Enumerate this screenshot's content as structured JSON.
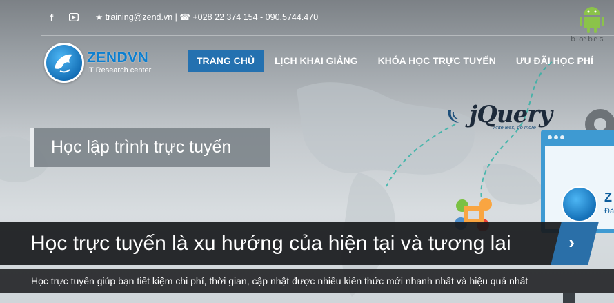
{
  "topbar": {
    "social": [
      {
        "icon": "facebook-icon",
        "glyph": "f"
      },
      {
        "icon": "youtube-icon",
        "glyph": "▶"
      }
    ],
    "contact_text": "★ training@zend.vn | ☎ +028 22 374 154 - 090.5744.470",
    "android_label": "android"
  },
  "logo": {
    "name": "ZENDVN",
    "tagline": "IT Research center"
  },
  "nav": {
    "items": [
      {
        "label": "TRANG CHỦ",
        "active": true
      },
      {
        "label": "LỊCH KHAI GIẢNG",
        "active": false
      },
      {
        "label": "KHÓA HỌC TRỰC TUYẾN",
        "active": false
      },
      {
        "label": "ƯU ĐÃI HỌC PHÍ",
        "active": false
      }
    ]
  },
  "decor": {
    "jquery_name": "jQuery",
    "jquery_tagline": "write less, do more",
    "monitor_brand": "Z",
    "monitor_sub": "Đà"
  },
  "hero": {
    "subtitle": "Học lập trình trực tuyến",
    "headline": "Học trực tuyến là xu hướng của hiện tại và tương lai",
    "next_glyph": "›",
    "description": "Học trực tuyến giúp bạn tiết kiệm chi phí, thời gian, cập nhật được nhiều kiến thức mới nhanh nhất và hiệu quả nhất"
  },
  "colors": {
    "accent": "#2471b0",
    "brand": "#0c7fd0",
    "banner_bg": "#181a1c"
  }
}
